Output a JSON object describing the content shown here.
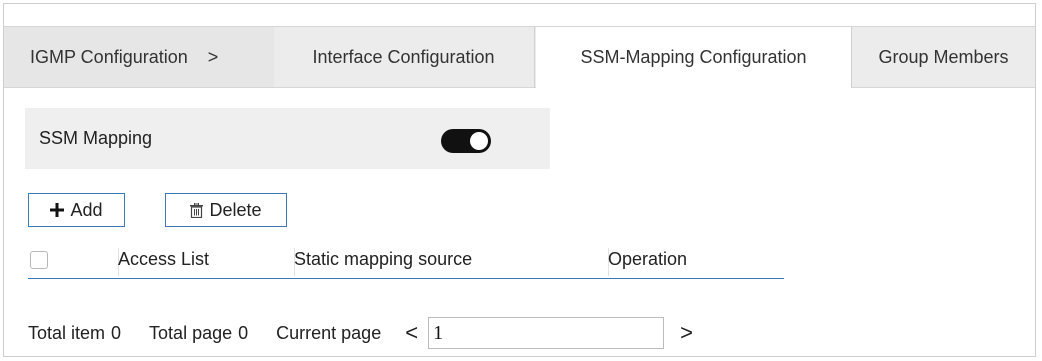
{
  "tabs": [
    {
      "label": "IGMP Configuration",
      "chevron": ">"
    },
    {
      "label": "Interface Configuration"
    },
    {
      "label": "SSM-Mapping Configuration",
      "active": true
    },
    {
      "label": "Group Members"
    }
  ],
  "ssm": {
    "label": "SSM Mapping",
    "toggle_state": "on"
  },
  "toolbar": {
    "add_label": "Add",
    "add_icon": "plus-icon",
    "delete_label": "Delete",
    "delete_icon": "trash-icon"
  },
  "table": {
    "columns": [
      "Access List",
      "Static mapping source",
      "Operation"
    ],
    "rows": []
  },
  "pager": {
    "total_item_label": "Total item",
    "total_item": "0",
    "total_page_label": "Total page",
    "total_page": "0",
    "current_page_label": "Current page",
    "current_page": "1",
    "prev_icon": "<",
    "next_icon": ">"
  },
  "colors": {
    "accent": "#3d78b8",
    "tab_bg": "#ececec",
    "panel_bg": "#efefef"
  }
}
